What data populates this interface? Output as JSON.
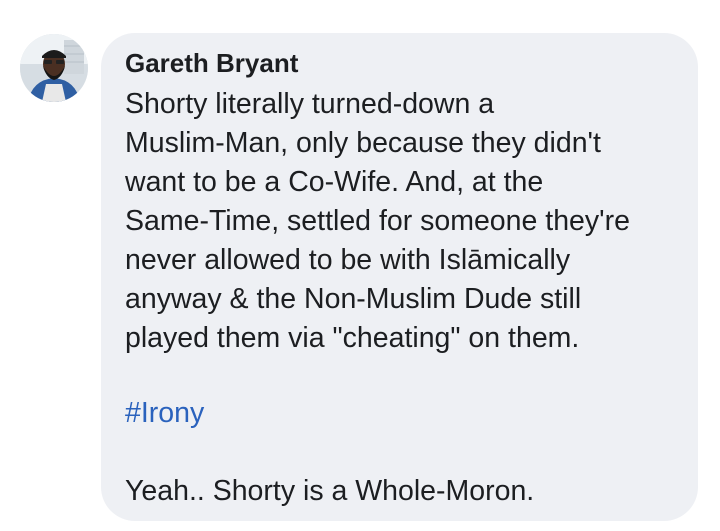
{
  "comment": {
    "author": "Gareth Bryant",
    "body_lines": [
      "Shorty literally turned-down a",
      "Muslim-Man, only because they didn't",
      "want to be a Co-Wife. And, at the",
      "Same-Time, settled for someone they're",
      "never allowed to be with Islāmically",
      "anyway & the Non-Muslim Dude still",
      "played them via \"cheating\" on them."
    ],
    "hashtag": "#Irony",
    "closing": "Yeah.. Shorty is a Whole-Moron."
  },
  "colors": {
    "bubble_background": "#eef0f4",
    "text": "#1c1e21",
    "hashtag": "#2a62bd"
  },
  "icons": {
    "avatar": "profile-photo"
  }
}
